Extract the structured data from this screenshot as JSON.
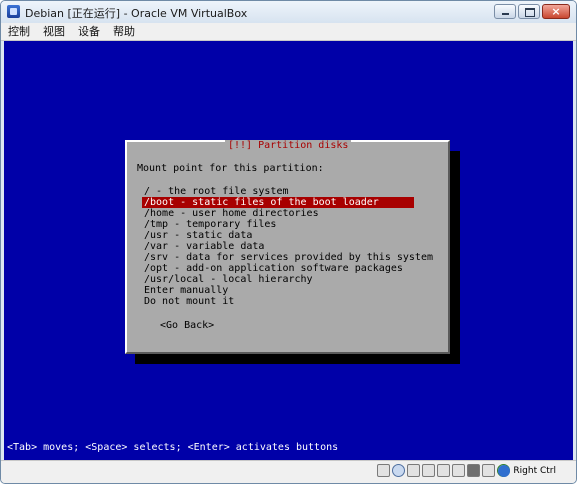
{
  "window": {
    "title": "Debian [正在运行] - Oracle VM VirtualBox",
    "icon": "virtualbox-icon",
    "buttons": [
      "minimize",
      "maximize",
      "close"
    ]
  },
  "menubar": {
    "items": [
      "控制",
      "视图",
      "设备",
      "帮助"
    ]
  },
  "installer": {
    "dialog_title": "[!!] Partition disks",
    "prompt": "Mount point for this partition:",
    "options": [
      "/ - the root file system",
      "/boot - static files of the boot loader",
      "/home - user home directories",
      "/tmp - temporary files",
      "/usr - static data",
      "/var - variable data",
      "/srv - data for services provided by this system",
      "/opt - add-on application software packages",
      "/usr/local - local hierarchy",
      "Enter manually",
      "Do not mount it"
    ],
    "selected_index": 1,
    "go_back": "<Go Back>",
    "hint": "<Tab> moves; <Space> selects; <Enter> activates buttons",
    "colors": {
      "background": "#0000a8",
      "dialog": "#aaaaaa",
      "highlight": "#a80000",
      "title_text": "#a80000"
    }
  },
  "statusbar": {
    "host_key": "Right Ctrl",
    "icons": [
      "hard-disk-icon",
      "optical-drive-icon",
      "floppy-icon",
      "usb-icon",
      "network-icon",
      "shared-folders-icon",
      "display-icon",
      "video-capture-icon",
      "mouse-integration-icon",
      "host-key-arrow-icon"
    ]
  }
}
